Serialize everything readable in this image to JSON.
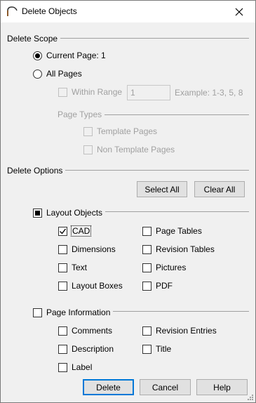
{
  "window": {
    "title": "Delete Objects"
  },
  "scope": {
    "heading": "Delete Scope",
    "current_page": "Current Page: 1",
    "all_pages": "All Pages",
    "within_range": "Within Range",
    "range_value": "1",
    "range_example": "Example: 1-3, 5, 8",
    "page_types": "Page Types",
    "template_pages": "Template Pages",
    "non_template_pages": "Non Template Pages"
  },
  "options": {
    "heading": "Delete Options",
    "select_all": "Select All",
    "clear_all": "Clear All",
    "layout_objects": {
      "label": "Layout Objects",
      "items": [
        {
          "label": "CAD",
          "checked": true
        },
        {
          "label": "Page Tables",
          "checked": false
        },
        {
          "label": "Dimensions",
          "checked": false
        },
        {
          "label": "Revision Tables",
          "checked": false
        },
        {
          "label": "Text",
          "checked": false
        },
        {
          "label": "Pictures",
          "checked": false
        },
        {
          "label": "Layout Boxes",
          "checked": false
        },
        {
          "label": "PDF",
          "checked": false
        }
      ]
    },
    "page_information": {
      "label": "Page Information",
      "items": [
        {
          "label": "Comments",
          "checked": false
        },
        {
          "label": "Revision Entries",
          "checked": false
        },
        {
          "label": "Description",
          "checked": false
        },
        {
          "label": "Title",
          "checked": false
        },
        {
          "label": "Label",
          "checked": false
        }
      ]
    }
  },
  "footer": {
    "delete": "Delete",
    "cancel": "Cancel",
    "help": "Help"
  },
  "colors": {
    "accent": "#0078d7",
    "dialog_bg": "#f0f0f0",
    "disabled_text": "#a0a0a0"
  }
}
